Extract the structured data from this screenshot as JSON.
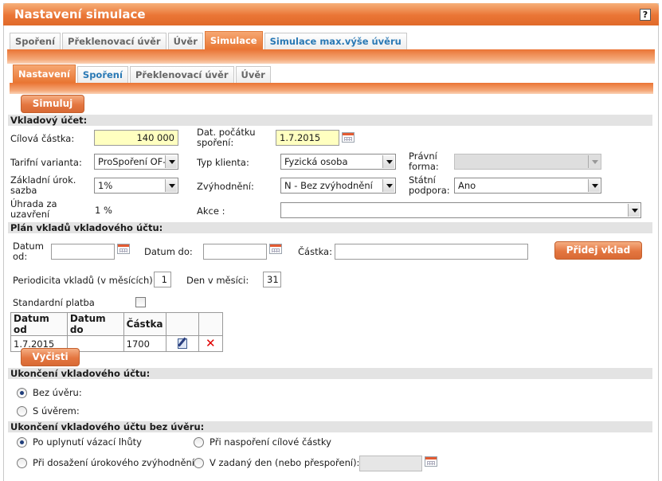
{
  "window": {
    "title": "Nastavení simulace",
    "help": "?"
  },
  "top_tabs": [
    "Spoření",
    "Překlenovací úvěr",
    "Úvěr",
    "Simulace",
    "Simulace max.výše úvěru"
  ],
  "sub_tabs": [
    "Nastavení",
    "Spoření",
    "Překlenovací úvěr",
    "Úvěr"
  ],
  "buttons": {
    "simulate": "Simuluj",
    "add_deposit": "Přidej vklad",
    "clear": "Vyčisti"
  },
  "deposit_account": {
    "section": "Vkladový účet:",
    "target_amount_label": "Cílová částka:",
    "target_amount": "140 000",
    "start_date_label": "Dat. počátku spoření:",
    "start_date": "1.7.2015",
    "tariff_label": "Tarifní varianta:",
    "tariff": "ProSpoření OF-",
    "client_type_label": "Typ klienta:",
    "client_type": "Fyzická osoba",
    "legal_form_label": "Právní forma:",
    "legal_form": "",
    "base_rate_label": "Základní úrok. sazba",
    "base_rate": "1%",
    "advantage_label": "Zvýhodnění:",
    "advantage": "N - Bez zvýhodnění",
    "state_support_label": "Státní podpora:",
    "state_support": "Ano",
    "closing_fee_label": "Úhrada za uzavření",
    "closing_fee": "1 %",
    "action_label": "Akce :",
    "action": ""
  },
  "deposit_plan": {
    "section": "Plán vkladů vkladového účtu:",
    "date_from_label": "Datum od:",
    "date_to_label": "Datum do:",
    "amount_label": "Částka:",
    "periodicity_label": "Periodicita vkladů (v měsících):",
    "periodicity": "1",
    "day_label": "Den v měsíci:",
    "day": "31",
    "standard_payment_label": "Standardní platba",
    "table": {
      "headers": [
        "Datum od",
        "Datum do",
        "Částka",
        "",
        ""
      ],
      "rows": [
        {
          "date_from": "1.7.2015",
          "date_to": "",
          "amount": "1700"
        }
      ]
    }
  },
  "termination": {
    "section": "Ukončení vkladového účtu:",
    "options": [
      "Bez úvěru:",
      "S úvěrem:"
    ],
    "selected": "Bez úvěru:"
  },
  "termination_no_loan": {
    "section": "Ukončení vkladového účtu bez úvěru:",
    "opt1": "Po uplynutí vázací lhůty",
    "opt2": "Při naspoření cílové částky",
    "opt3": "Při dosažení úrokového zvýhodnění",
    "opt4": "V zadaný den (nebo přespoření):",
    "selected": "Po uplynutí vázací lhůty"
  }
}
